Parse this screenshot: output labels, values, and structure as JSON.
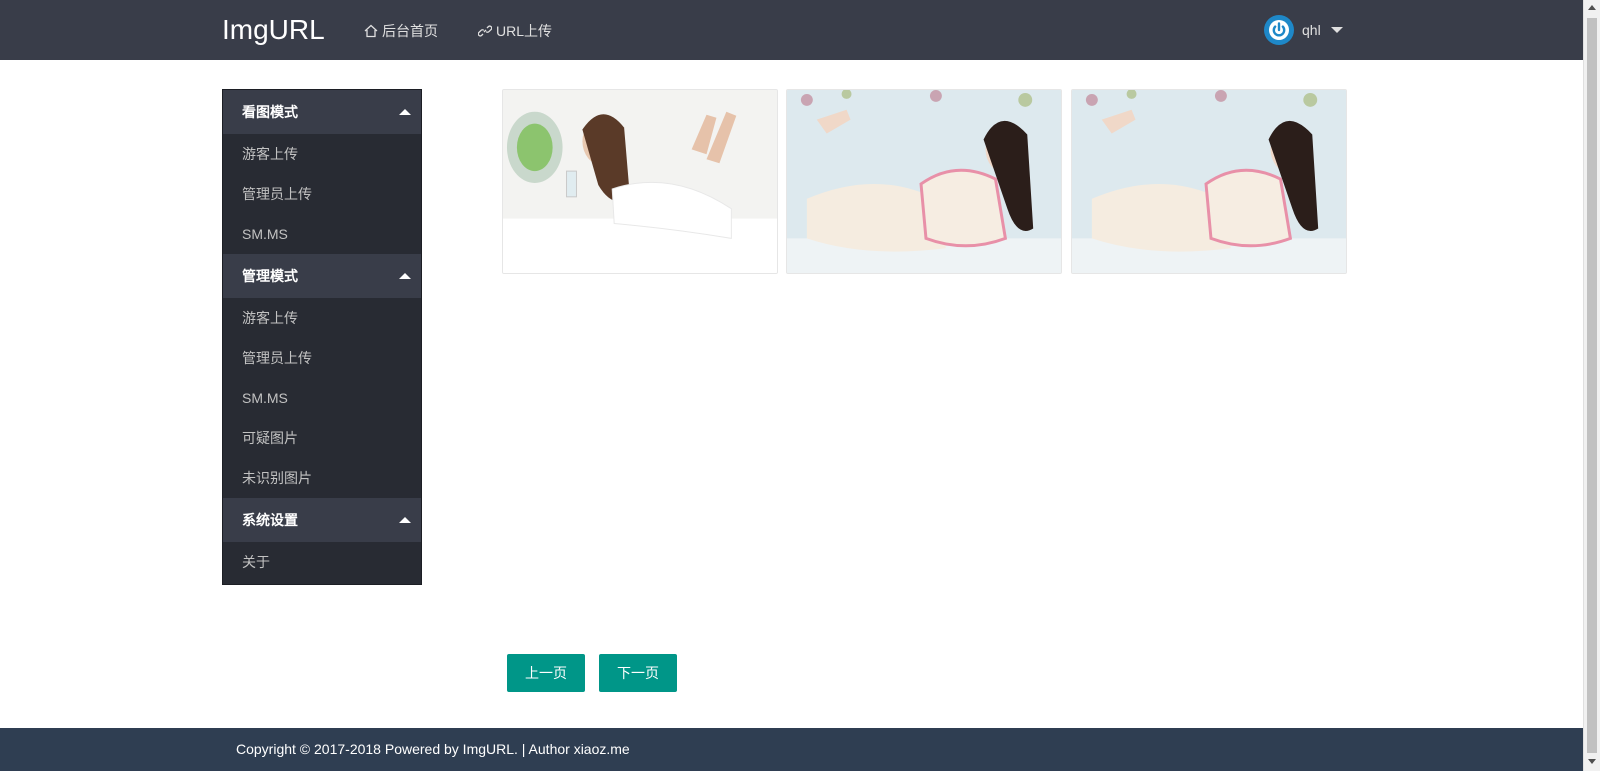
{
  "header": {
    "brand": "ImgURL",
    "nav": [
      {
        "label": "后台首页",
        "icon": "home-icon"
      },
      {
        "label": "URL上传",
        "icon": "link-icon"
      }
    ],
    "user": {
      "name": "qhl",
      "icon": "power-icon"
    }
  },
  "sidebar": {
    "groups": [
      {
        "title": "看图模式",
        "items": [
          "游客上传",
          "管理员上传",
          "SM.MS"
        ]
      },
      {
        "title": "管理模式",
        "items": [
          "游客上传",
          "管理员上传",
          "SM.MS",
          "可疑图片",
          "未识别图片"
        ]
      },
      {
        "title": "系统设置",
        "items": [
          "关于"
        ]
      }
    ]
  },
  "gallery": {
    "images": [
      {
        "icon": "photo-woman-white-bed"
      },
      {
        "icon": "photo-woman-floral"
      },
      {
        "icon": "photo-woman-floral"
      }
    ]
  },
  "pager": {
    "prev": "上一页",
    "next": "下一页"
  },
  "footer": {
    "text": "Copyright © 2017-2018 Powered by ImgURL. | Author xiaoz.me"
  },
  "colors": {
    "topbar": "#393d49",
    "sidebar": "#282b33",
    "button": "#009688",
    "footer": "#2f3e52",
    "avatar": "#1e88c8"
  }
}
